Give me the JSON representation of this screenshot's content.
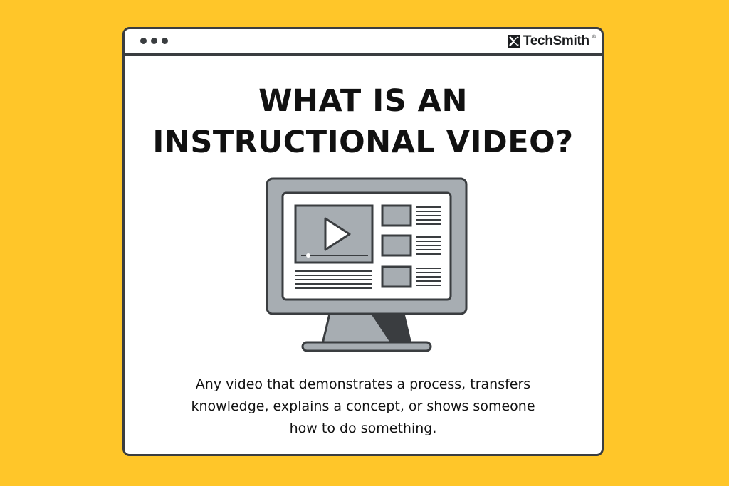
{
  "window": {
    "brand": {
      "name": "TechSmith",
      "registered": "®",
      "icon": "techsmith-logo-icon"
    }
  },
  "headline": {
    "line1": "WHAT IS AN",
    "line2": "INSTRUCTIONAL VIDEO?"
  },
  "illustration": {
    "icon": "monitor-with-video-player-icon",
    "colors": {
      "outline": "#3a3d40",
      "fill": "#a7adb2",
      "screen": "#ffffff",
      "dark": "#3a3d40"
    }
  },
  "caption": {
    "line1": "Any video that demonstrates a process, transfers",
    "line2": "knowledge, explains a concept, or shows someone",
    "line3": "how to do something."
  },
  "colors": {
    "background": "#FFC629",
    "window_border": "#3a3d40"
  }
}
